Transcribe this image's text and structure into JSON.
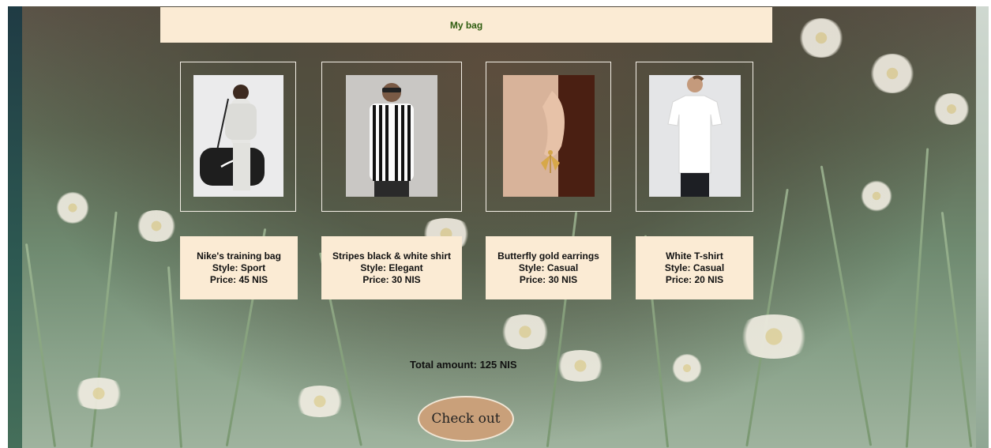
{
  "header": {
    "title": "My bag"
  },
  "items": [
    {
      "title": "Nike's training bag",
      "style": "Style: Sport",
      "price": "Price: 45 NIS",
      "image": "woman-with-black-duffel-bag"
    },
    {
      "title": "Stripes black & white shirt",
      "style": "Style: Elegant",
      "price": "Price: 30 NIS",
      "image": "man-in-striped-shirt"
    },
    {
      "title": "Butterfly gold earrings",
      "style": "Style: Casual",
      "price": "Price: 30 NIS",
      "image": "butterfly-earring-closeup"
    },
    {
      "title": "White T-shirt",
      "style": "Style: Casual",
      "price": "Price: 20 NIS",
      "image": "man-in-white-tshirt"
    }
  ],
  "summary": {
    "total": "Total amount: 125 NIS"
  },
  "actions": {
    "checkout": "Check out"
  },
  "colors": {
    "panel": "#fbebd4",
    "header_text": "#2f5d10",
    "button": "#c9a07a"
  }
}
